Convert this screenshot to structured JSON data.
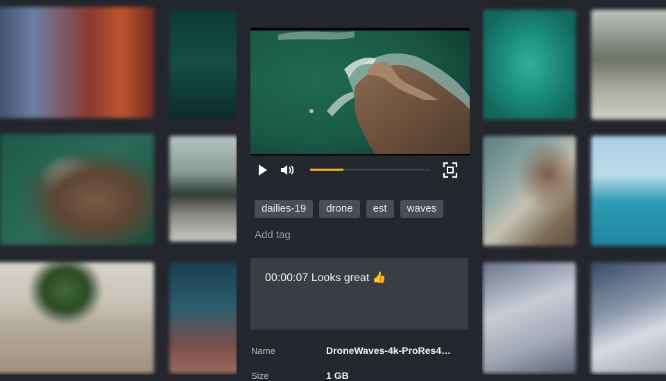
{
  "player": {
    "play_icon": "play-icon",
    "volume_icon": "volume-icon",
    "fullscreen_icon": "fullscreen-icon",
    "progress": 0.28,
    "accent": "#f3b21a"
  },
  "tags": [
    "dailies-19",
    "drone",
    "est",
    "waves"
  ],
  "add_tag_placeholder": "Add tag",
  "comment": {
    "text": "00:00:07 Looks great 👍"
  },
  "meta": [
    {
      "label": "Name",
      "value": "DroneWaves-4k-ProRes4…"
    },
    {
      "label": "Size",
      "value": "1 GB"
    }
  ]
}
